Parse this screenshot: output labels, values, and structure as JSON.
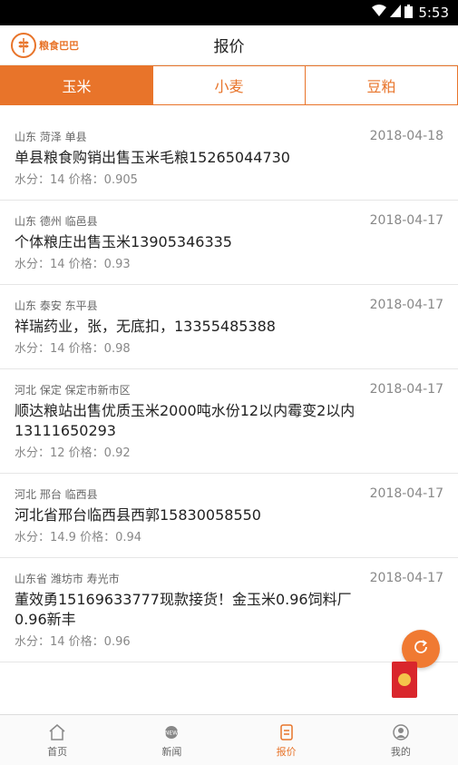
{
  "statusbar": {
    "time": "5:53"
  },
  "appbar": {
    "logo_text": "粮食巴巴",
    "title": "报价"
  },
  "tabs": [
    {
      "label": "玉米",
      "active": true
    },
    {
      "label": "小麦",
      "active": false
    },
    {
      "label": "豆粕",
      "active": false
    }
  ],
  "items": [
    {
      "location": "山东 菏泽 单县",
      "date": "2018-04-18",
      "title": "单县粮食购销出售玉米毛粮15265044730",
      "meta": "水分：14 价格：0.905"
    },
    {
      "location": "山东 德州 临邑县",
      "date": "2018-04-17",
      "title": "个体粮庄出售玉米13905346335",
      "meta": "水分：14 价格：0.93"
    },
    {
      "location": "山东 泰安 东平县",
      "date": "2018-04-17",
      "title": "祥瑞药业，张，无底扣，13355485388",
      "meta": "水分：14 价格：0.98"
    },
    {
      "location": "河北 保定 保定市新市区",
      "date": "2018-04-17",
      "title": "顺达粮站出售优质玉米2000吨水份12以内霉变2以内13111650293",
      "meta": "水分：12 价格：0.92"
    },
    {
      "location": "河北 邢台 临西县",
      "date": "2018-04-17",
      "title": "河北省邢台临西县西郭15830058550",
      "meta": "水分：14.9 价格：0.94"
    },
    {
      "location": "山东省 潍坊市 寿光市",
      "date": "2018-04-17",
      "title": "董效勇15169633777现款接货！金玉米0.96饲料厂0.96新丰",
      "meta": "水分：14 价格：0.96"
    }
  ],
  "bottomnav": [
    {
      "label": "首页",
      "icon": "home-icon",
      "active": false
    },
    {
      "label": "新闻",
      "icon": "news-icon",
      "active": false
    },
    {
      "label": "报价",
      "icon": "quote-icon",
      "active": true
    },
    {
      "label": "我的",
      "icon": "profile-icon",
      "active": false
    }
  ],
  "colors": {
    "accent": "#e8742a",
    "red": "#d9262c"
  }
}
